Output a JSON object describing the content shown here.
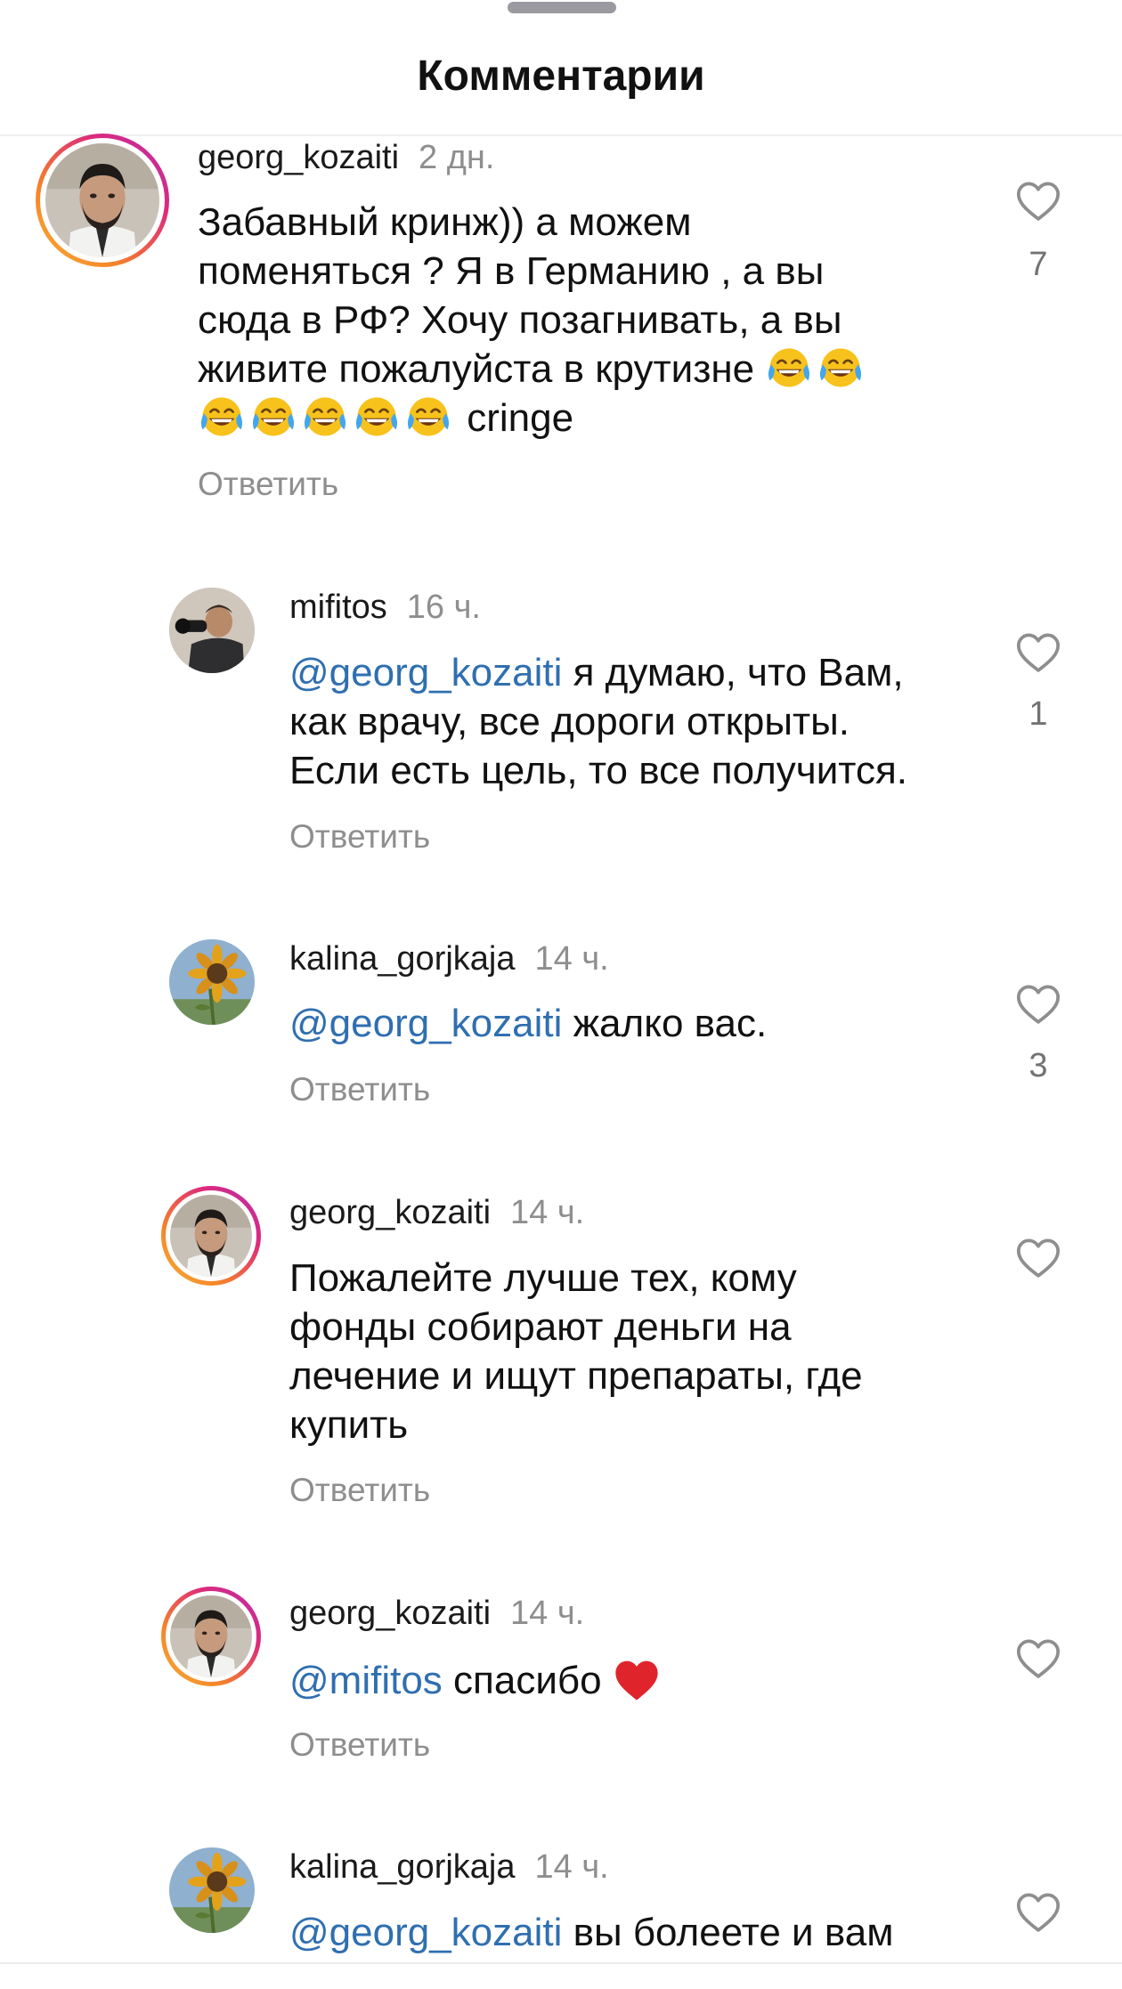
{
  "sheet": {
    "title": "Комментарии"
  },
  "colors": {
    "mention": "#2f6fb0",
    "muted": "#8e8e8e",
    "story_ring": [
      "#f7b338",
      "#f58529",
      "#dd2a7b",
      "#b62fb0"
    ]
  },
  "comments": [
    {
      "username": "georg_kozaiti",
      "time": "2 дн.",
      "text_before": "Забавный кринж)) а можем\nпоменяться ? Я в Германию , а вы\nсюда в РФ? Хочу позагнивать, а вы\nживите пожалуйста в крутизне ",
      "text_after": " cringe",
      "emoji": "face-with-tears-of-joy",
      "reply_label": "Ответить",
      "likes": "7",
      "avatar": "avatar-georg",
      "story_ring": true
    },
    {
      "username": "mifitos",
      "time": "16 ч.",
      "mention": "@georg_kozaiti",
      "text": " я думаю, что Вам,\nкак врачу, все дороги открыты.\nЕсли есть цель, то все получится.",
      "reply_label": "Ответить",
      "likes": "1",
      "avatar": "avatar-mifitos",
      "story_ring": false
    },
    {
      "username": "kalina_gorjkaja",
      "time": "14 ч.",
      "mention": "@georg_kozaiti",
      "text": " жалко вас.",
      "reply_label": "Ответить",
      "likes": "3",
      "avatar": "avatar-sunflower",
      "story_ring": false
    },
    {
      "username": "georg_kozaiti",
      "time": "14 ч.",
      "text": "Пожалейте лучше тех, кому\nфонды собирают деньги на\nлечение и ищут препараты, где\nкупить",
      "reply_label": "Ответить",
      "likes": "",
      "avatar": "avatar-georg",
      "story_ring": true
    },
    {
      "username": "georg_kozaiti",
      "time": "14 ч.",
      "mention": "@mifitos",
      "text": " спасибо ",
      "emoji": "red-heart",
      "reply_label": "Ответить",
      "likes": "",
      "avatar": "avatar-georg",
      "story_ring": true
    },
    {
      "username": "kalina_gorjkaja",
      "time": "14 ч.",
      "mention": "@georg_kozaiti",
      "text": " вы болеете и вам",
      "likes": "",
      "avatar": "avatar-sunflower",
      "story_ring": false
    }
  ]
}
